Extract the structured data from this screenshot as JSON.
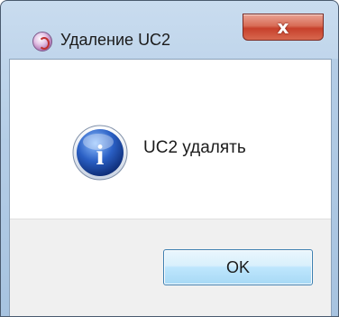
{
  "window": {
    "title": "Удаление UC2",
    "close_symbol": "x",
    "app_icon": "app-logo-icon"
  },
  "dialog": {
    "icon": "info-icon",
    "icon_glyph": "i",
    "message": "UC2 удалять",
    "ok_label": "OK"
  },
  "colors": {
    "title_gradient_top": "#c9dcef",
    "close_red": "#c7402b",
    "info_blue": "#1e4fb0",
    "footer_bg": "#f0f0f0",
    "button_border": "#3c7fb1"
  }
}
